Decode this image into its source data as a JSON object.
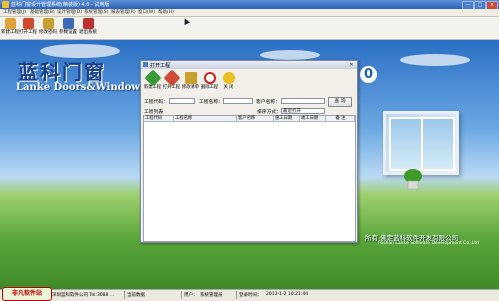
{
  "window": {
    "title": "蓝科门窗设计管理系统(精装版) 4.0 - 试用版",
    "min": "—",
    "max": "□",
    "close": "×"
  },
  "menu": [
    "工程管理(J)",
    "基础管理(B)",
    "设计管理(D)",
    "系统管理(S)",
    "报表管理(R)",
    "窗口(W)",
    "帮助(H)"
  ],
  "toolbar": [
    {
      "label": "新建工程",
      "icon": "new-project-icon",
      "color": "#e2a23a"
    },
    {
      "label": "打开工程",
      "icon": "open-project-icon",
      "color": "#d04a2a"
    },
    {
      "label": "修改密码",
      "icon": "password-key-icon",
      "color": "#c8a030"
    },
    {
      "label": "参数设置",
      "icon": "settings-icon",
      "color": "#3a6ab8"
    },
    {
      "label": "退出系统",
      "icon": "exit-icon",
      "color": "#c03030"
    }
  ],
  "background": {
    "brand_cn": "蓝科门窗",
    "brand_en": "Lanke Doors&Windows",
    "brand_badge": "0",
    "company_cn": "所有  佛定蓝科软件开发有限公司",
    "company_en": "Foshan Lanke Software Development Co.,Ltd"
  },
  "dialog": {
    "title": "打开工程",
    "buttons": [
      {
        "label": "新建工程",
        "icon": "new-project-icon",
        "color": "#3a9a3a"
      },
      {
        "label": "打开工程",
        "icon": "open-project-icon",
        "color": "#d04a3a"
      },
      {
        "label": "修改清单",
        "icon": "edit-list-icon",
        "color": "#c8a030"
      },
      {
        "label": "删除工程",
        "icon": "delete-icon",
        "color": "#d02020"
      },
      {
        "label": "关  闭",
        "icon": "close-circle-icon",
        "color": "#e8c020"
      }
    ],
    "fields": {
      "project_code_label": "工程代码：",
      "project_name_label": "工程名称：",
      "customer_name_label": "客户名称：",
      "query_button": "查  询",
      "sort_label": "排序方式：",
      "sort_value": "最近打开",
      "list_label": "工程列表"
    },
    "columns": [
      "工程代码",
      "工程名称",
      "客户名称",
      "施工日期",
      "竣工日期",
      "备  注"
    ]
  },
  "statusbar": {
    "company": "深圳蓝科软件公司 Tel:3088 ...",
    "database_label": "当前数据",
    "user_label": "用户：",
    "user_value": "系统管理员",
    "time_label": "登录时间：",
    "time_value": "2013-1-2 10:21:44"
  },
  "watermark": "非凡软件站"
}
